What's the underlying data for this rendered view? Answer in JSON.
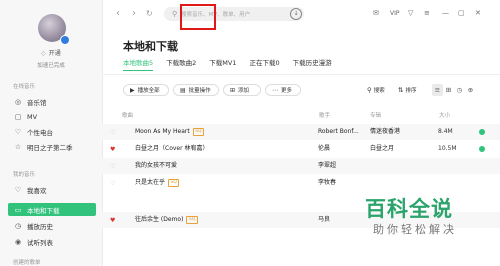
{
  "sidebar": {
    "vip_label": "开通",
    "sync_status": "加速已完成",
    "sections": [
      {
        "title": "在线音乐",
        "items": [
          {
            "icon": "music-hall-icon",
            "glyph": "◎",
            "label": "音乐馆"
          },
          {
            "icon": "video-icon",
            "glyph": "▢",
            "label": "MV"
          },
          {
            "icon": "radio-icon",
            "glyph": "♡",
            "label": "个性电台"
          },
          {
            "icon": "star-icon",
            "glyph": "☆",
            "label": "明日之子第二季"
          }
        ]
      },
      {
        "title": "我的音乐",
        "items": [
          {
            "icon": "heart-icon",
            "glyph": "♡",
            "label": "我喜欢"
          },
          {
            "icon": "local-download-icon",
            "glyph": "▭",
            "label": "本地和下载",
            "active": true
          },
          {
            "icon": "history-icon",
            "glyph": "◷",
            "label": "播放历史"
          },
          {
            "icon": "trial-list-icon",
            "glyph": "◉",
            "label": "试听列表"
          }
        ]
      },
      {
        "title": "创建的歌单",
        "items": []
      }
    ]
  },
  "topbar": {
    "search_placeholder": "搜索音乐、MV、歌单、用户",
    "icons": [
      "mail-icon",
      "vip-icon",
      "skin-icon",
      "menu-icon",
      "minimize-icon",
      "maximize-icon",
      "close-icon"
    ],
    "vip_text": "VIP"
  },
  "main": {
    "title": "本地和下载",
    "tabs": [
      "本地歌曲5",
      "下载歌曲2",
      "下载MV1",
      "正在下载0",
      "下载历史漫游"
    ],
    "buttons": {
      "play_all": "播放全部",
      "batch": "批量操作",
      "add": "添加",
      "more": "更多"
    },
    "search_label": "搜索",
    "sort_label": "排序",
    "columns": {
      "title": "歌曲",
      "singer": "歌手",
      "album": "专辑",
      "size": "大小"
    },
    "rows": [
      {
        "title": "Moon As My Heart",
        "tag": "SQ",
        "singer": "Robert Bonf...",
        "album": "情迷夜香港",
        "size": "8.4M",
        "liked": false,
        "done": true
      },
      {
        "title": "白昼之月（Cover 林宥嘉）",
        "tag": "",
        "singer": "伦晨",
        "album": "白昼之月",
        "size": "10.5M",
        "liked": true,
        "done": true
      },
      {
        "title": "我的女孩不可爱",
        "tag": "",
        "singer": "李翠超",
        "album": "",
        "size": "",
        "liked": false,
        "done": false
      },
      {
        "title": "只是太在乎",
        "tag": "SQ",
        "singer": "李牧春",
        "album": "",
        "size": "",
        "liked": false,
        "done": false
      },
      {
        "title": "往后余生 (Demo)",
        "tag": "SQ",
        "singer": "马良",
        "album": "",
        "size": "",
        "liked": true,
        "done": false
      }
    ]
  },
  "watermark": {
    "title": "百科全说",
    "subtitle": "助你轻松解决"
  }
}
